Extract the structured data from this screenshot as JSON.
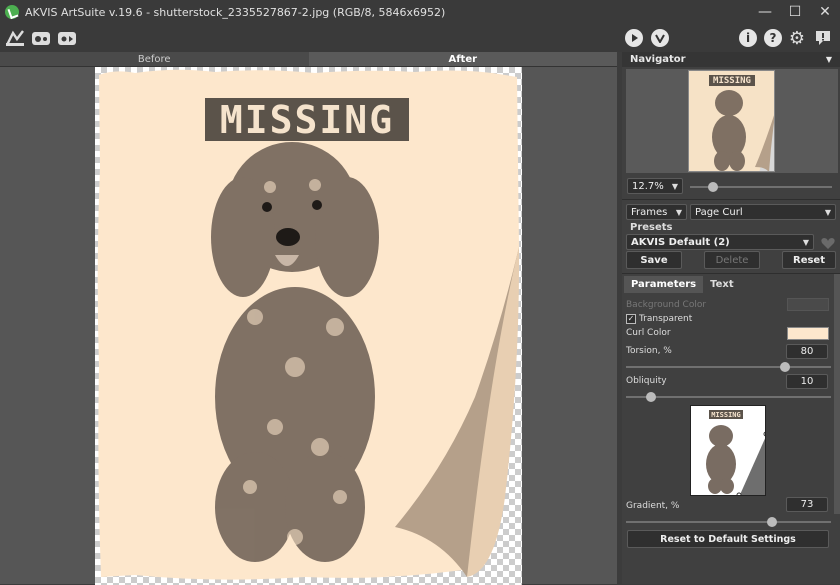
{
  "window": {
    "title": "AKVIS ArtSuite v.19.6 - shutterstock_2335527867-2.jpg (RGB/8, 5846x6952)",
    "minimize": "—",
    "maximize": "☐",
    "close": "✕"
  },
  "toolbar": {
    "left_icons": [
      "open-icon",
      "save-icon",
      "batch-icon"
    ],
    "right_icons": [
      "play-icon",
      "apply-icon",
      "info-icon",
      "help-icon",
      "settings-icon",
      "notification-icon"
    ],
    "info_glyph": "i",
    "help_glyph": "?",
    "settings_glyph": "⚙",
    "notify_glyph": "!"
  },
  "canvas": {
    "tab_before": "Before",
    "tab_after": "After",
    "poster_text": "MISSING"
  },
  "navigator": {
    "title": "Navigator",
    "thumb_text": "MISSING",
    "zoom": "12.7%"
  },
  "effect": {
    "category": "Frames",
    "frame": "Page Curl",
    "presets_label": "Presets",
    "preset_value": "AKVIS Default (2)",
    "save": "Save",
    "delete": "Delete",
    "reset": "Reset"
  },
  "params": {
    "tab_parameters": "Parameters",
    "tab_text": "Text",
    "background_color_label": "Background Color",
    "transparent_label": "Transparent",
    "transparent_checked": true,
    "curl_color_label": "Curl Color",
    "curl_color": "#fde7cd",
    "torsion_label": "Torsion, %",
    "torsion_value": "80",
    "obliquity_label": "Obliquity",
    "obliquity_value": "10",
    "preview_text": "MISSING",
    "gradient_label": "Gradient, %",
    "gradient_value": "73",
    "reset_defaults": "Reset to Default Settings"
  }
}
